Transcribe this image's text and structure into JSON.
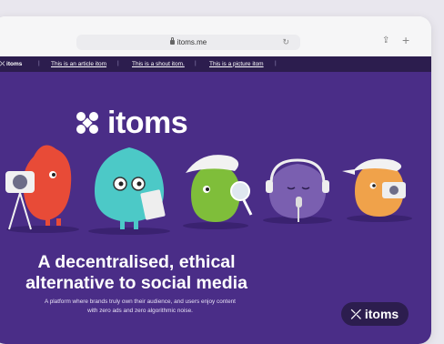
{
  "browser": {
    "url": "itoms.me",
    "share_icon": "share-icon",
    "new_tab_icon": "plus-icon",
    "reload_icon": "reload-icon",
    "lock_icon": "lock-icon"
  },
  "nav": {
    "logo": "itoms",
    "links": [
      "This is an article itom",
      "This is a shout itom.",
      "This is a picture itom"
    ],
    "separator": "|"
  },
  "hero": {
    "logo": "itoms",
    "headline_line1": "A decentralised, ethical",
    "headline_line2": "alternative to social media",
    "subtext_line1": "A platform where brands truly own their audience, and users enjoy content",
    "subtext_line2": "with zero ads and zero algorithmic noise."
  },
  "badge": {
    "label": "itoms"
  },
  "colors": {
    "background": "#4a2d87",
    "navbar": "#2c1d4e",
    "red_character": "#e84b37",
    "teal_character": "#4cc9c7",
    "green_character": "#7fbe3a",
    "purple_character": "#7a5fb0",
    "orange_character": "#f0a24a"
  }
}
